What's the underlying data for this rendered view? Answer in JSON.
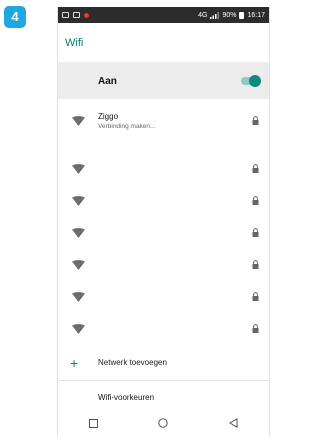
{
  "badge": {
    "number": "4"
  },
  "status_bar": {
    "network": "4G",
    "battery": "90%",
    "time": "16:17",
    "icons": [
      "image-icon",
      "square-icon",
      "notification-dot-icon",
      "signal-icon",
      "battery-icon"
    ]
  },
  "app_bar": {
    "title": "Wifi"
  },
  "master": {
    "label": "Aan",
    "enabled": true
  },
  "networks": [
    {
      "name": "Ziggo",
      "status": "Verbinding maken...",
      "secured": true
    }
  ],
  "hidden_networks_count": 6,
  "actions": {
    "add_network": "Netwerk toevoegen",
    "preferences": "Wifi-voorkeuren"
  },
  "nav": {
    "icons": [
      "recent-apps-icon",
      "home-icon",
      "back-icon"
    ]
  },
  "colors": {
    "accent": "#11897b",
    "badge": "#1ea7e1",
    "status_bar": "#2c2c2c"
  }
}
